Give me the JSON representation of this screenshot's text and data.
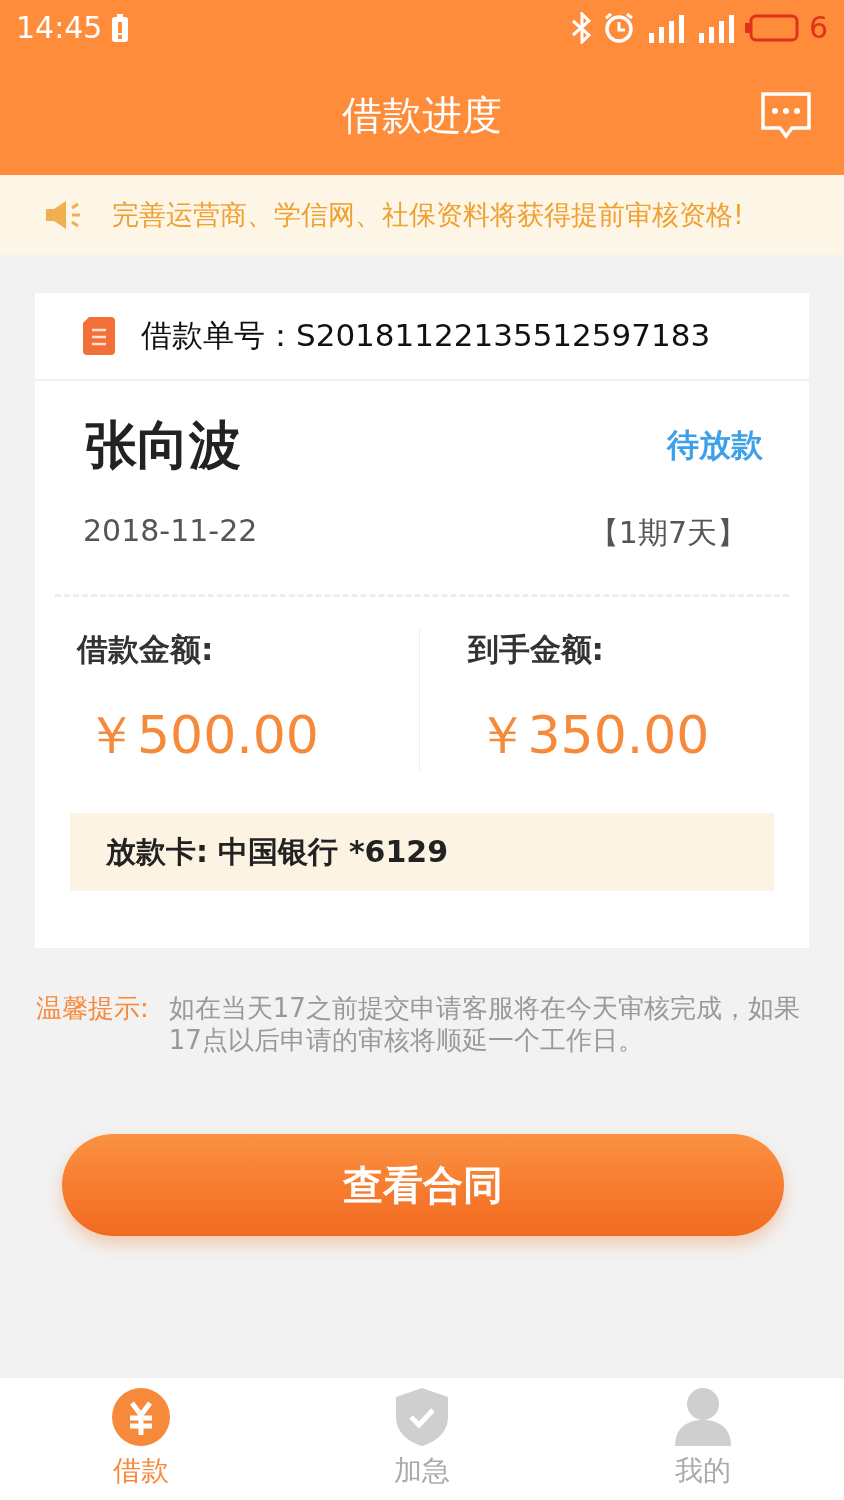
{
  "status_bar": {
    "time": "14:45",
    "battery": "6"
  },
  "header": {
    "title": "借款进度"
  },
  "notice": {
    "text": "完善运营商、学信网、社保资料将获得提前审核资格!"
  },
  "order": {
    "number_label": "借款单号：S20181122135512597183",
    "name": "张向波",
    "status": "待放款",
    "date": "2018-11-22",
    "term": "【1期7天】",
    "amounts": [
      {
        "label": "借款金额:",
        "value": "￥500.00"
      },
      {
        "label": "到手金额:",
        "value": "￥350.00"
      }
    ],
    "card": "放款卡: 中国银行 *6129"
  },
  "tip": {
    "label": "温馨提示:",
    "text": "如在当天17之前提交申请客服将在今天审核完成，如果17点以后申请的审核将顺延一个工作日。"
  },
  "action_button": "查看合同",
  "nav": [
    {
      "label": "借款",
      "kind": "yen",
      "selected": true
    },
    {
      "label": "加急",
      "kind": "shield",
      "selected": false
    },
    {
      "label": "我的",
      "kind": "person",
      "selected": false
    }
  ]
}
